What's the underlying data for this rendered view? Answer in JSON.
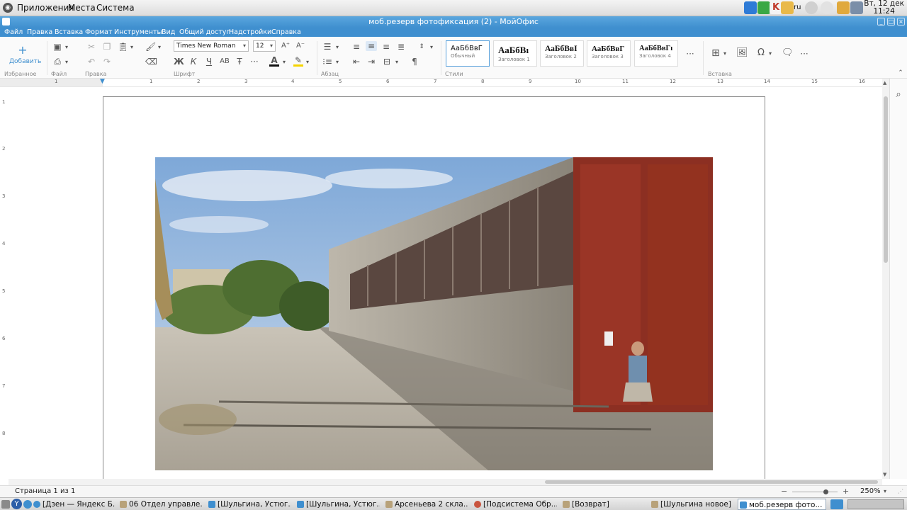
{
  "system_bar": {
    "menus": [
      "Приложения",
      "Места",
      "Система"
    ],
    "lang": "ru",
    "clock_day": "Вт, 12 дек",
    "clock_time": "11:24"
  },
  "window": {
    "title": "моб.резерв фотофиксация (2) - МойОфис"
  },
  "menubar": [
    "Файл",
    "Правка",
    "Вставка",
    "Формат",
    "Инструменты",
    "Вид",
    "Общий доступ",
    "Надстройки",
    "Справка"
  ],
  "ribbon": {
    "add_label": "Добавить",
    "groups": {
      "favorites": "Избранное",
      "file": "Файл",
      "edit": "Правка",
      "font": "Шрифт",
      "paragraph": "Абзац",
      "styles": "Стили",
      "insert": "Вставка"
    },
    "font_name": "Times New Roman",
    "font_size": "12",
    "font_buttons": {
      "bold": "Ж",
      "italic": "К",
      "underline": "Ч",
      "strike": "АВ",
      "clear": "Ŧ",
      "more": "···"
    },
    "styles": [
      {
        "preview": "АаБбВвГ",
        "name": "Обычный"
      },
      {
        "preview": "АаБбВı",
        "name": "Заголовок 1"
      },
      {
        "preview": "АаБбВвI",
        "name": "Заголовок 2"
      },
      {
        "preview": "АаБбВвГ",
        "name": "Заголовок 3"
      },
      {
        "preview": "АаБбВвГı",
        "name": "Заголовок 4"
      }
    ],
    "more": "···",
    "colors": {
      "accent": "#3f8fcf",
      "font_color": "#111111",
      "highlight": "#f5d400"
    }
  },
  "ruler": {
    "h_numbers": [
      "1",
      "1",
      "2",
      "3",
      "4",
      "5",
      "6",
      "7",
      "8",
      "9",
      "10",
      "11",
      "12",
      "13",
      "14",
      "15",
      "16"
    ],
    "v_numbers": [
      "1",
      "2",
      "3",
      "4",
      "5",
      "6",
      "7",
      "8"
    ]
  },
  "statusbar": {
    "page_info": "Страница 1 из 1",
    "zoom_minus": "−",
    "zoom_plus": "+",
    "zoom": "250%",
    "zoom_level": 0.6
  },
  "taskbar": [
    {
      "label": "[Дзен — Яндекс Б...",
      "icon": "yandex-browser-icon",
      "active": false
    },
    {
      "label": "06 Отдел управле...",
      "icon": "folder-icon",
      "active": false
    },
    {
      "label": "[Шульгина, Устюг...",
      "icon": "myoffice-icon",
      "active": false
    },
    {
      "label": "[Шульгина, Устюг...",
      "icon": "myoffice-icon",
      "active": false
    },
    {
      "label": "Арсеньева 2 скла...",
      "icon": "folder-icon",
      "active": false
    },
    {
      "label": "[Подсистема Обр...",
      "icon": "app-icon",
      "active": false
    },
    {
      "label": "[Возврат]",
      "icon": "folder-icon",
      "active": false
    },
    {
      "label": "[Шульгина новое]",
      "icon": "folder-icon",
      "active": false
    },
    {
      "label": "моб.резерв фото...",
      "icon": "myoffice-icon",
      "active": true
    }
  ],
  "document": {
    "image_description_icon": "photo-warehouse"
  }
}
